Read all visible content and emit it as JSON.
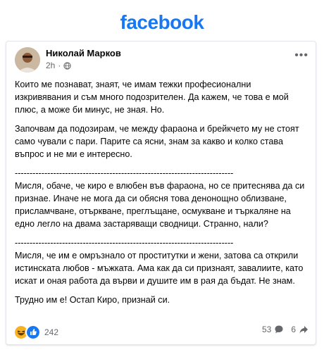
{
  "brand": {
    "logo_text": "facebook",
    "color": "#1877f2"
  },
  "post": {
    "author": "Николай Марков",
    "time": "2h",
    "privacy_icon": "globe-icon",
    "more_icon": "more-dots-icon",
    "paragraphs": [
      "Които ме познават, знаят, че имам тежки професионални изкривявания и съм много подозрителен. Да кажем, че това е мой плюс, а може би минус, не зная. Но.",
      "Започвам да подозирам, че между фараона и брейкчето му не стоят само чували с пари. Парите са ясни, знам за какво и колко става въпрос и не ми е интересно.",
      "--------------------------------------------------------------------------\nМисля, обаче, че киро е влюбен във фараона, но се притеснява да си признае. Иначе не мога да си обясня това денонощно облизване, присламчване, отъркване, преглъщане, осмукване и търкаляне на едно легло на двама застаряващи сводници. Странно, нали?",
      "--------------------------------------------------------------------------\nМисля, че им е омръзнало от проститутки и жени, затова са открили истинската любов - мъжката. Ама как да си признаят, завалиите, като искат и оная работа да върви и душите им в рая да бъдат. Не знам.",
      "Трудно им е! Остап Киро, признай си."
    ],
    "reactions": {
      "icons": [
        "haha-icon",
        "like-icon"
      ],
      "count": "242"
    },
    "comments": {
      "count": "53",
      "icon": "comment-icon"
    },
    "shares": {
      "count": "6",
      "icon": "share-icon"
    }
  }
}
